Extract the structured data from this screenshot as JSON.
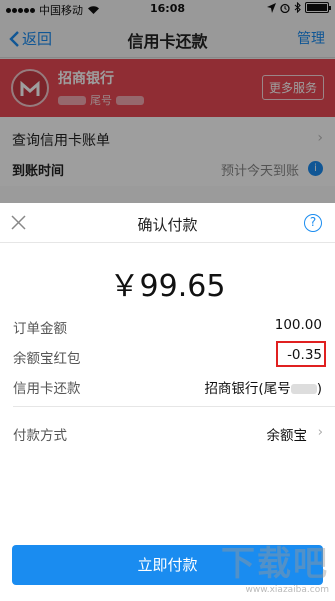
{
  "status_bar": {
    "carrier": "中国移动",
    "wifi_icon": "wifi-icon",
    "time": "16:08",
    "alarm_icon": "alarm-icon"
  },
  "nav": {
    "back_label": "返回",
    "title": "信用卡还款",
    "manage_label": "管理"
  },
  "bank_card": {
    "name": "招商银行",
    "tail_label": "尾号",
    "more_label": "更多服务",
    "brand_color": "#e94a55"
  },
  "query": {
    "label": "查询信用卡账单"
  },
  "arrival": {
    "label": "到账时间",
    "hint": "预计今天到账"
  },
  "sheet": {
    "title": "确认付款",
    "help_symbol": "?",
    "amount": "￥99.65",
    "rows": {
      "order_label": "订单金额",
      "order_value": "100.00",
      "bonus_label": "余额宝红包",
      "bonus_value": "-0.35",
      "card_label": "信用卡还款",
      "card_value_prefix": "招商银行(尾号",
      "card_value_suffix": ")",
      "method_label": "付款方式",
      "method_value": "余额宝"
    },
    "pay_button": "立即付款",
    "accent_color": "#1a8cf0",
    "highlight_color": "#e02020"
  },
  "watermark": {
    "brand": "下载吧",
    "url": "www.xiazaiba.com"
  }
}
